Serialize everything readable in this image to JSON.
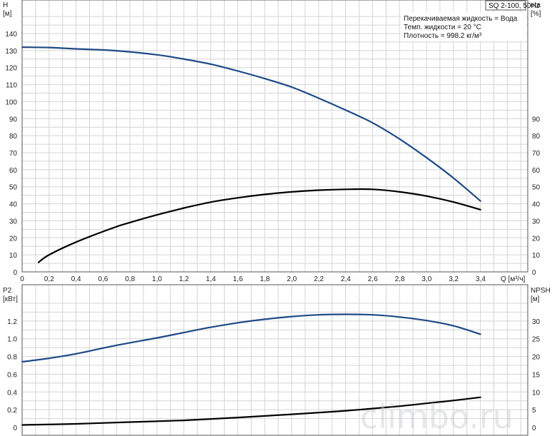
{
  "colors": {
    "head_curve": "#1f4a86",
    "eta_curve": "#000000",
    "grid": "#d4d4d4",
    "frame": "#555555"
  },
  "watermark": "climbo.ru",
  "chart_data": [
    {
      "type": "line",
      "title": "SQ 2-100, 50Hz",
      "annotations": [
        "Перекачиваемая жидкость = Вода",
        "Темп. жидкости = 20 °C",
        "Плотность = 998.2 кг/м³"
      ],
      "xlabel": "Q [м³/ч]",
      "ylabel": "H\n[м]",
      "ylabel_right": "eta\n[%]",
      "xlim": [
        0,
        3.4
      ],
      "ylim": [
        0,
        150
      ],
      "ylim_right": [
        0,
        150
      ],
      "grid": true,
      "x_ticks": [
        "0",
        "0,2",
        "0,4",
        "0,6",
        "0,8",
        "1,0",
        "1,2",
        "1,4",
        "1,6",
        "1,8",
        "2,0",
        "2,2",
        "2,4",
        "2,6",
        "2,8",
        "3,0",
        "3,2",
        "3,4"
      ],
      "y_ticks": [
        "0",
        "10",
        "20",
        "30",
        "40",
        "50",
        "60",
        "70",
        "80",
        "90",
        "100",
        "110",
        "120",
        "130",
        "140"
      ],
      "y_ticks_right": [
        "0",
        "10",
        "20",
        "30",
        "40",
        "50",
        "60",
        "70",
        "80",
        "90"
      ],
      "series": [
        {
          "axis": "left",
          "x": [
            0,
            0.2,
            0.4,
            0.68,
            1.0,
            1.2,
            1.4,
            1.6,
            1.8,
            2.0,
            2.2,
            2.4,
            2.6,
            2.8,
            3.0,
            3.2,
            3.4
          ],
          "y": [
            132,
            131.8,
            131,
            130,
            127.5,
            125,
            122,
            118,
            113.5,
            108.5,
            102,
            95,
            87.5,
            78,
            67,
            55,
            41.5
          ]
        },
        {
          "axis": "right",
          "x": [
            0.12,
            0.2,
            0.4,
            0.68,
            0.8,
            1.0,
            1.2,
            1.4,
            1.6,
            1.8,
            2.0,
            2.2,
            2.4,
            2.6,
            2.8,
            3.0,
            3.2,
            3.4
          ],
          "y": [
            5.5,
            10,
            17.5,
            26,
            29,
            33.5,
            37.5,
            41,
            43.5,
            45.5,
            47,
            48,
            48.5,
            48.5,
            47,
            44.5,
            41,
            36.5
          ]
        }
      ]
    },
    {
      "type": "line",
      "ylabel": "P2\n[кВт]",
      "ylabel_right": "NPSH\n[м]",
      "xlim": [
        0,
        3.4
      ],
      "ylim": [
        0,
        1.4
      ],
      "ylim_right": [
        0,
        35
      ],
      "grid": true,
      "y_ticks": [
        "0",
        "0.2",
        "0.4",
        "0.6",
        "0.8",
        "1.0",
        "1.2"
      ],
      "y_ticks_right": [
        "0",
        "5",
        "10",
        "15",
        "20",
        "25",
        "30"
      ],
      "series": [
        {
          "axis": "left",
          "x": [
            0,
            0.2,
            0.4,
            0.68,
            1.0,
            1.2,
            1.4,
            1.6,
            1.8,
            2.0,
            2.2,
            2.4,
            2.6,
            2.8,
            3.0,
            3.2,
            3.4
          ],
          "y": [
            0.74,
            0.78,
            0.83,
            0.92,
            1.01,
            1.07,
            1.13,
            1.18,
            1.22,
            1.25,
            1.27,
            1.275,
            1.27,
            1.245,
            1.205,
            1.145,
            1.05
          ]
        },
        {
          "axis": "right",
          "x": [
            0,
            0.4,
            0.8,
            1.2,
            1.6,
            2.0,
            2.4,
            2.8,
            3.0,
            3.2,
            3.4
          ],
          "y": [
            0.7,
            1.0,
            1.5,
            2.0,
            2.8,
            3.7,
            4.7,
            6.0,
            6.8,
            7.6,
            8.5
          ]
        }
      ]
    }
  ]
}
